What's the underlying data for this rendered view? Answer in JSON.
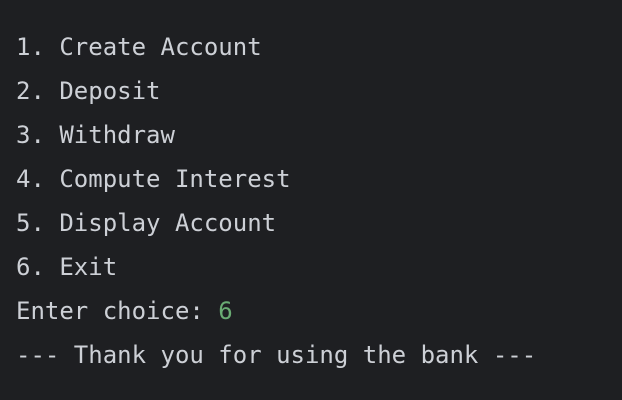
{
  "menu": {
    "items": [
      "1. Create Account",
      "2. Deposit",
      "3. Withdraw",
      "4. Compute Interest",
      "5. Display Account",
      "6. Exit"
    ]
  },
  "prompt": {
    "label": "Enter choice: ",
    "input": "6"
  },
  "farewell": "--- Thank you for using the bank ---",
  "colors": {
    "background": "#1e1f22",
    "text": "#cdd0d6",
    "input": "#6aab73"
  }
}
